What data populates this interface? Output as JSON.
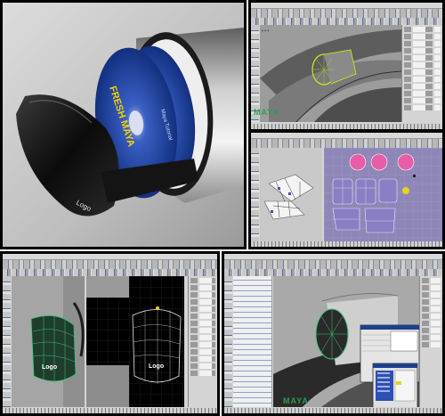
{
  "render": {
    "disc_text": "FRESH MAYA",
    "disc_sub": "Maya Tutorial",
    "logo_text": "Logo",
    "watermark": "MAYA",
    "colors": {
      "background": "#ffffff",
      "viewport_gray": "#a8a8a8",
      "uv_purple": "#7c6ea8",
      "wire_green": "#2f9b4d",
      "disc_blue": "#1e3f9a",
      "ui_gray": "#d4d4d4"
    }
  },
  "panels": [
    {
      "id": "product-render",
      "label": ""
    },
    {
      "id": "maya-modeling-view",
      "label": ""
    },
    {
      "id": "maya-uv-editor",
      "label": ""
    },
    {
      "id": "maya-wireframe-logo",
      "label": ""
    },
    {
      "id": "maya-outliner-view",
      "label": ""
    }
  ]
}
